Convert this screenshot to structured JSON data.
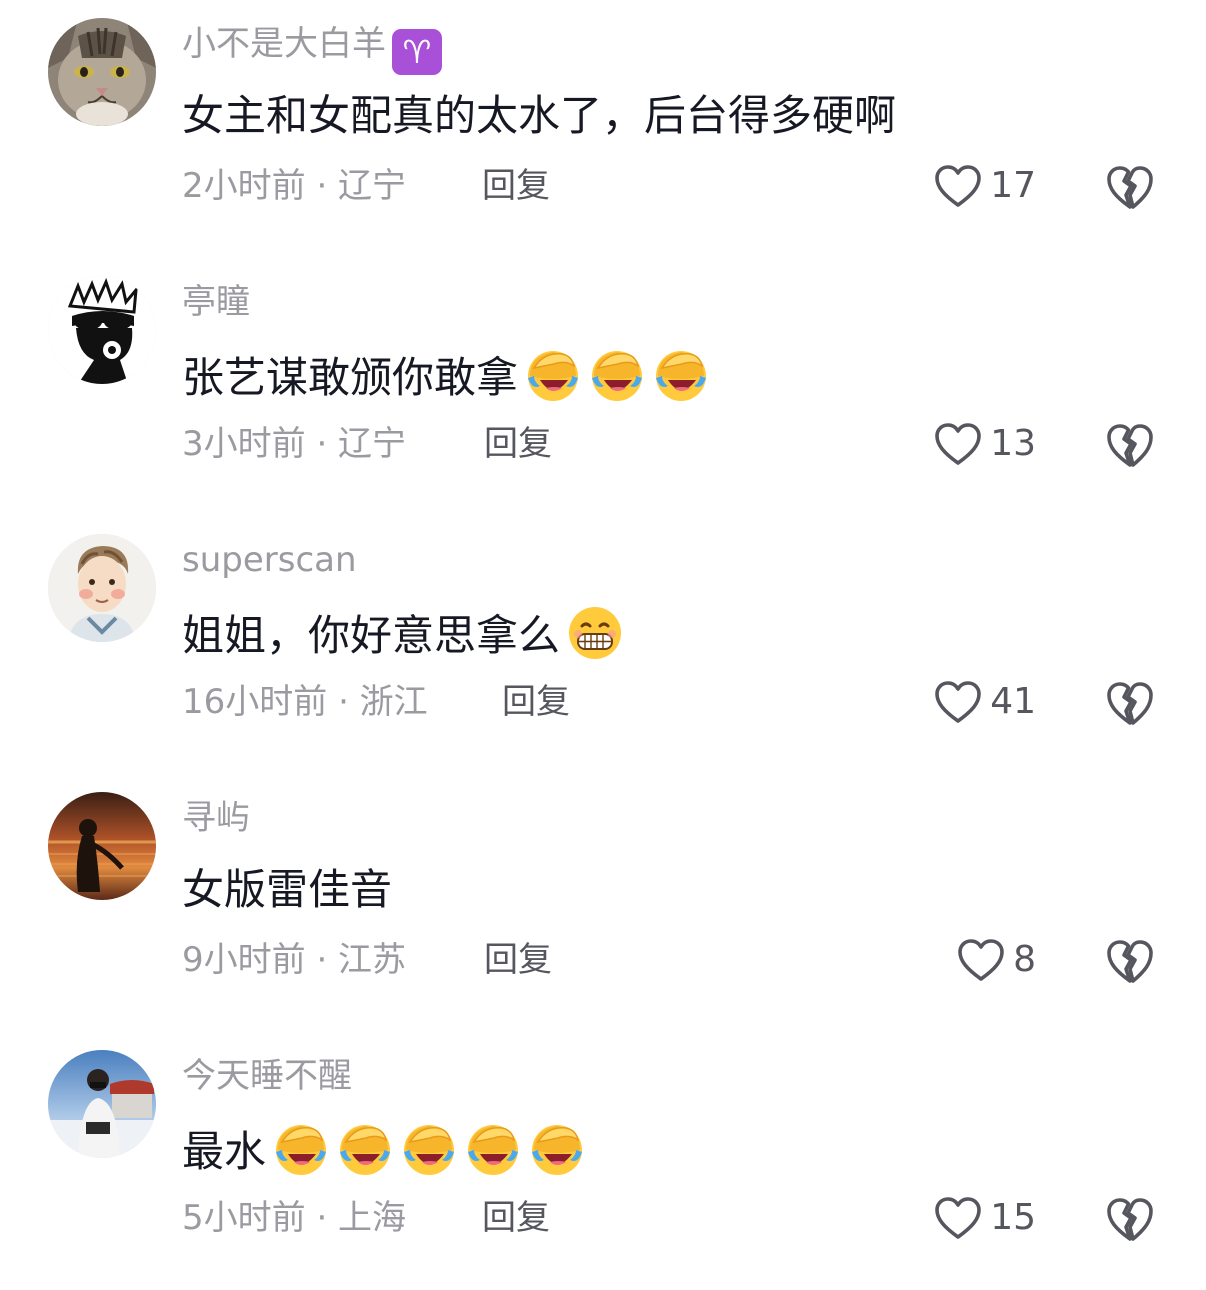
{
  "comments": [
    {
      "username": "小不是大白羊",
      "badge": "♈",
      "text": "女主和女配真的太水了，后台得多硬啊",
      "time": "2小时前",
      "location": "辽宁",
      "meta": "2小时前 · 辽宁",
      "reply_label": "回复",
      "likes": "17",
      "avatar": "cat-avatar",
      "emojis": []
    },
    {
      "username": "亭瞳",
      "text": "张艺谋敢颁你敢拿",
      "time": "3小时前",
      "location": "辽宁",
      "meta": "3小时前 · 辽宁",
      "reply_label": "回复",
      "likes": "13",
      "avatar": "sunglasses-cartoon-avatar",
      "emojis": [
        "facepalm-laughing-emoji",
        "facepalm-laughing-emoji",
        "facepalm-laughing-emoji"
      ]
    },
    {
      "username": "superscan",
      "text": "姐姐，你好意思拿么",
      "time": "16小时前",
      "location": "浙江",
      "meta": "16小时前 · 浙江",
      "reply_label": "回复",
      "likes": "41",
      "avatar": "illustrated-boy-avatar",
      "emojis": [
        "grinning-teeth-emoji"
      ]
    },
    {
      "username": "寻屿",
      "text": "女版雷佳音",
      "time": "9小时前",
      "location": "江苏",
      "meta": "9小时前 · 江苏",
      "reply_label": "回复",
      "likes": "8",
      "avatar": "sunset-silhouette-avatar",
      "emojis": []
    },
    {
      "username": "今天睡不醒",
      "text": "最水",
      "time": "5小时前",
      "location": "上海",
      "meta": "5小时前 · 上海",
      "reply_label": "回复",
      "likes": "15",
      "avatar": "winter-photo-avatar",
      "emojis": [
        "facepalm-laughing-emoji",
        "facepalm-laughing-emoji",
        "facepalm-laughing-emoji",
        "facepalm-laughing-emoji",
        "facepalm-laughing-emoji"
      ]
    }
  ],
  "colors": {
    "username": "#9a9aa0",
    "text": "#161823",
    "meta": "#9a9aa0",
    "action": "#55565e",
    "badge": "#a950d8"
  },
  "icons": {
    "like": "heart-outline-icon",
    "dislike": "broken-heart-icon"
  }
}
